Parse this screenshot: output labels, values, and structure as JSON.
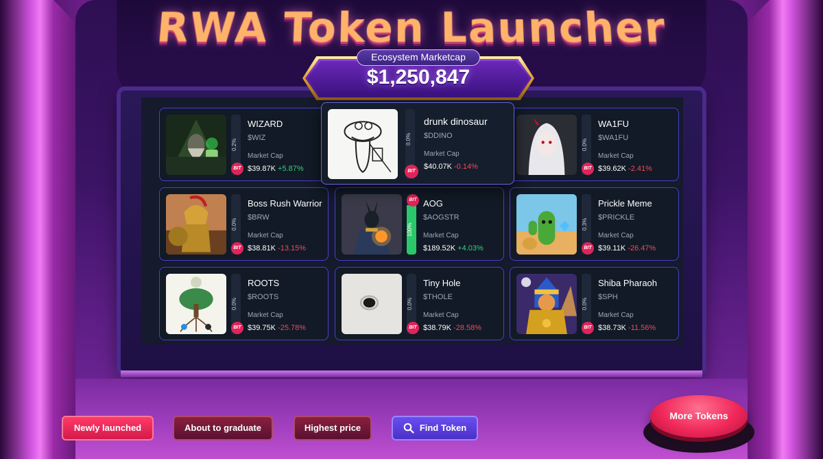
{
  "header": {
    "title": "RWA Token Launcher",
    "ecosystem_label": "Ecosystem Marketcap",
    "ecosystem_value": "$1,250,847"
  },
  "common": {
    "market_cap_label": "Market Cap",
    "badge_text": "BIT"
  },
  "tokens": [
    {
      "name": "WIZARD",
      "ticker": "$WIZ",
      "progress_text": "0.2%",
      "progress": 0.2,
      "market_cap": "$39.87K",
      "change": "+5.87%",
      "trend": "pos",
      "image_icon": "wizard-image"
    },
    {
      "name": "drunk dinosaur",
      "ticker": "$DDINO",
      "progress_text": "0.0%",
      "progress": 0.0,
      "market_cap": "$40.07K",
      "change": "-0.14%",
      "trend": "neg",
      "image_icon": "dinosaur-image"
    },
    {
      "name": "WA1FU",
      "ticker": "$WA1FU",
      "progress_text": "0.0%",
      "progress": 0.0,
      "market_cap": "$39.62K",
      "change": "-2.41%",
      "trend": "neg",
      "image_icon": "anime-girl-image"
    },
    {
      "name": "Boss Rush Warrior",
      "ticker": "$BRW",
      "progress_text": "0.0%",
      "progress": 0.0,
      "market_cap": "$38.81K",
      "change": "-13.15%",
      "trend": "neg",
      "image_icon": "warrior-image"
    },
    {
      "name": "AOG",
      "ticker": "$AOGSTR",
      "progress_text": "100%",
      "progress": 100,
      "market_cap": "$189.52K",
      "change": "+4.03%",
      "trend": "pos",
      "image_icon": "anubis-image"
    },
    {
      "name": "Prickle Meme",
      "ticker": "$PRICKLE",
      "progress_text": "0.3%",
      "progress": 0.3,
      "market_cap": "$39.11K",
      "change": "-26.47%",
      "trend": "neg",
      "image_icon": "cactus-image"
    },
    {
      "name": "ROOTS",
      "ticker": "$ROOTS",
      "progress_text": "0.0%",
      "progress": 0.0,
      "market_cap": "$39.75K",
      "change": "-25.78%",
      "trend": "neg",
      "image_icon": "tree-image"
    },
    {
      "name": "Tiny Hole",
      "ticker": "$THOLE",
      "progress_text": "0.0%",
      "progress": 0.0,
      "market_cap": "$38.79K",
      "change": "-28.58%",
      "trend": "neg",
      "image_icon": "hole-image"
    },
    {
      "name": "Shiba Pharaoh",
      "ticker": "$SPH",
      "progress_text": "0.0%",
      "progress": 0.0,
      "market_cap": "$38.73K",
      "change": "-11.56%",
      "trend": "neg",
      "image_icon": "shiba-pharaoh-image"
    }
  ],
  "buttons": {
    "newly_launched": "Newly launched",
    "about_to_graduate": "About to graduate",
    "highest_price": "Highest price",
    "find_token": "Find Token",
    "more_tokens": "More Tokens"
  },
  "colors": {
    "positive": "#34d37a",
    "negative": "#f2495a",
    "card_border": "#4b3ed0",
    "badge": "#e0245a",
    "progress_fill": "#2ac86a"
  }
}
